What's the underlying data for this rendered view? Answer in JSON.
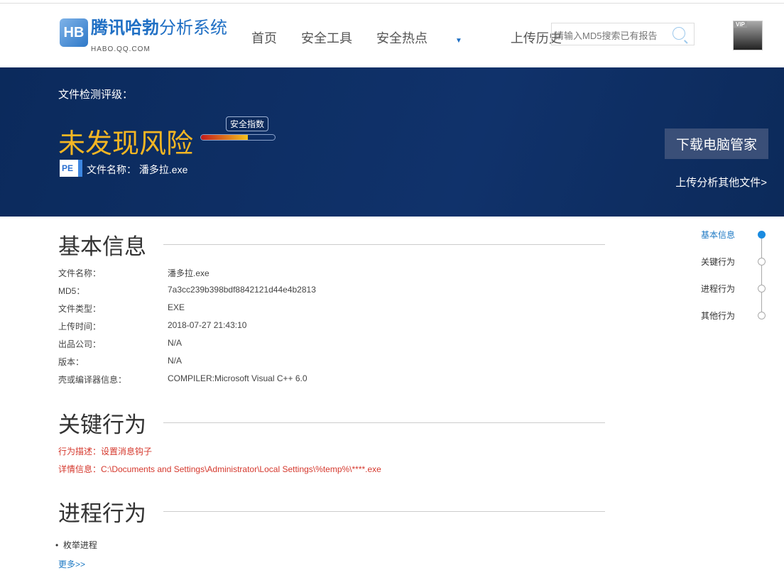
{
  "header": {
    "logo_bold": "腾讯哈勃",
    "logo_light": "分析系统",
    "logo_sub": "HABO.QQ.COM",
    "nav": [
      "首页",
      "安全工具",
      "安全热点",
      "上传历史"
    ],
    "search_placeholder": "请输入MD5搜索已有报告",
    "avatar_badge": "VIP"
  },
  "banner": {
    "label": "文件检测评级：",
    "risk": "未发现风险",
    "tip": "安全指数",
    "safety_index_fraction": 0.63,
    "pe": "PE",
    "file_label": "文件名称：",
    "file_name": "潘多拉.exe",
    "download": "下载电脑管家",
    "upload_other": "上传分析其他文件>"
  },
  "basic": {
    "title": "基本信息",
    "rows": [
      {
        "k": "文件名称：",
        "v": "潘多拉.exe"
      },
      {
        "k": "MD5：",
        "v": "7a3cc239b398bdf8842121d44e4b2813"
      },
      {
        "k": "文件类型：",
        "v": "EXE"
      },
      {
        "k": "上传时间：",
        "v": "2018-07-27 21:43:10"
      },
      {
        "k": "出品公司：",
        "v": "N/A"
      },
      {
        "k": "版本：",
        "v": "N/A"
      },
      {
        "k": "壳或编译器信息：",
        "v": "COMPILER:Microsoft Visual C++ 6.0"
      }
    ]
  },
  "key": {
    "title": "关键行为",
    "desc": "行为描述：设置消息钩子",
    "detail": "详情信息：C:\\Documents and Settings\\Administrator\\Local Settings\\%temp%\\****.exe"
  },
  "process": {
    "title": "进程行为",
    "items": [
      "枚举进程"
    ],
    "more": "更多>>"
  },
  "side_nav": [
    "基本信息",
    "关键行为",
    "进程行为",
    "其他行为"
  ],
  "colors": {
    "accent": "#1f7ac4",
    "risk": "#f5b623",
    "banner": "#0b2a5c",
    "alert": "#d5382d"
  }
}
